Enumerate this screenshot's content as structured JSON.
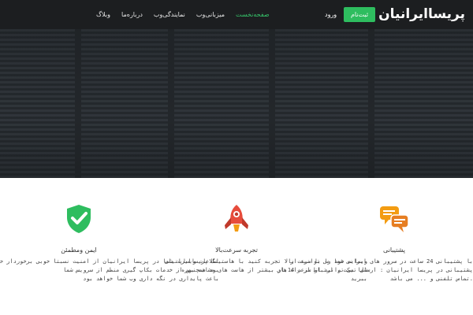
{
  "header": {
    "brand": "پریساایرانیان",
    "signup_label": "ثبت‌نام",
    "login_label": "ورود",
    "nav": [
      {
        "label": "صفحه‌نخست",
        "active": true
      },
      {
        "label": "میزبانی‌وب",
        "active": false
      },
      {
        "label": "نمایندگی‌وب",
        "active": false
      },
      {
        "label": "درباره‌ما",
        "active": false
      },
      {
        "label": "وبلاگ",
        "active": false
      }
    ]
  },
  "colors": {
    "accent_green": "#2ebd5f",
    "shield_green": "#2ebd5f",
    "rocket_red": "#e74c3c",
    "chat_orange": "#f39c12"
  },
  "features": [
    {
      "icon": "chat-icon",
      "title": "پشتیبانی",
      "lines": [
        "با پشتیبانی 24 ساعت در سرور های ایرانی شما می توانید از",
        "پشتیبانی در پریسا ایرانیان : ارسال تیکت , ارتباط از راه های",
        ".تماس تلفنی و ... می باشد"
      ]
    },
    {
      "icon": "rocket-icon",
      "title": "تجربه سرعت‌بالا",
      "lines": [
        "وبسایت خود را با سرعت بالا تجربه کنید با هاستینگ پریساایرانیان",
        "شما می توانید از سرعت 14بار بیشتر از هاست های مشابه بهره",
        "ببرید"
      ]
    },
    {
      "icon": "shield-check-icon",
      "title": "ایمن ومطمئن",
      "lines": [
        "اطلاعات وبسایت شما در پریسا ایرانیان از امنیت نسبتا خوبی برخوردار خواهید",
        "بود همچنین از خدمات بکاپ گیری منظم از سرویس شما",
        "باعث پایداری در نگه داری وب شما خواهد بود"
      ]
    }
  ]
}
